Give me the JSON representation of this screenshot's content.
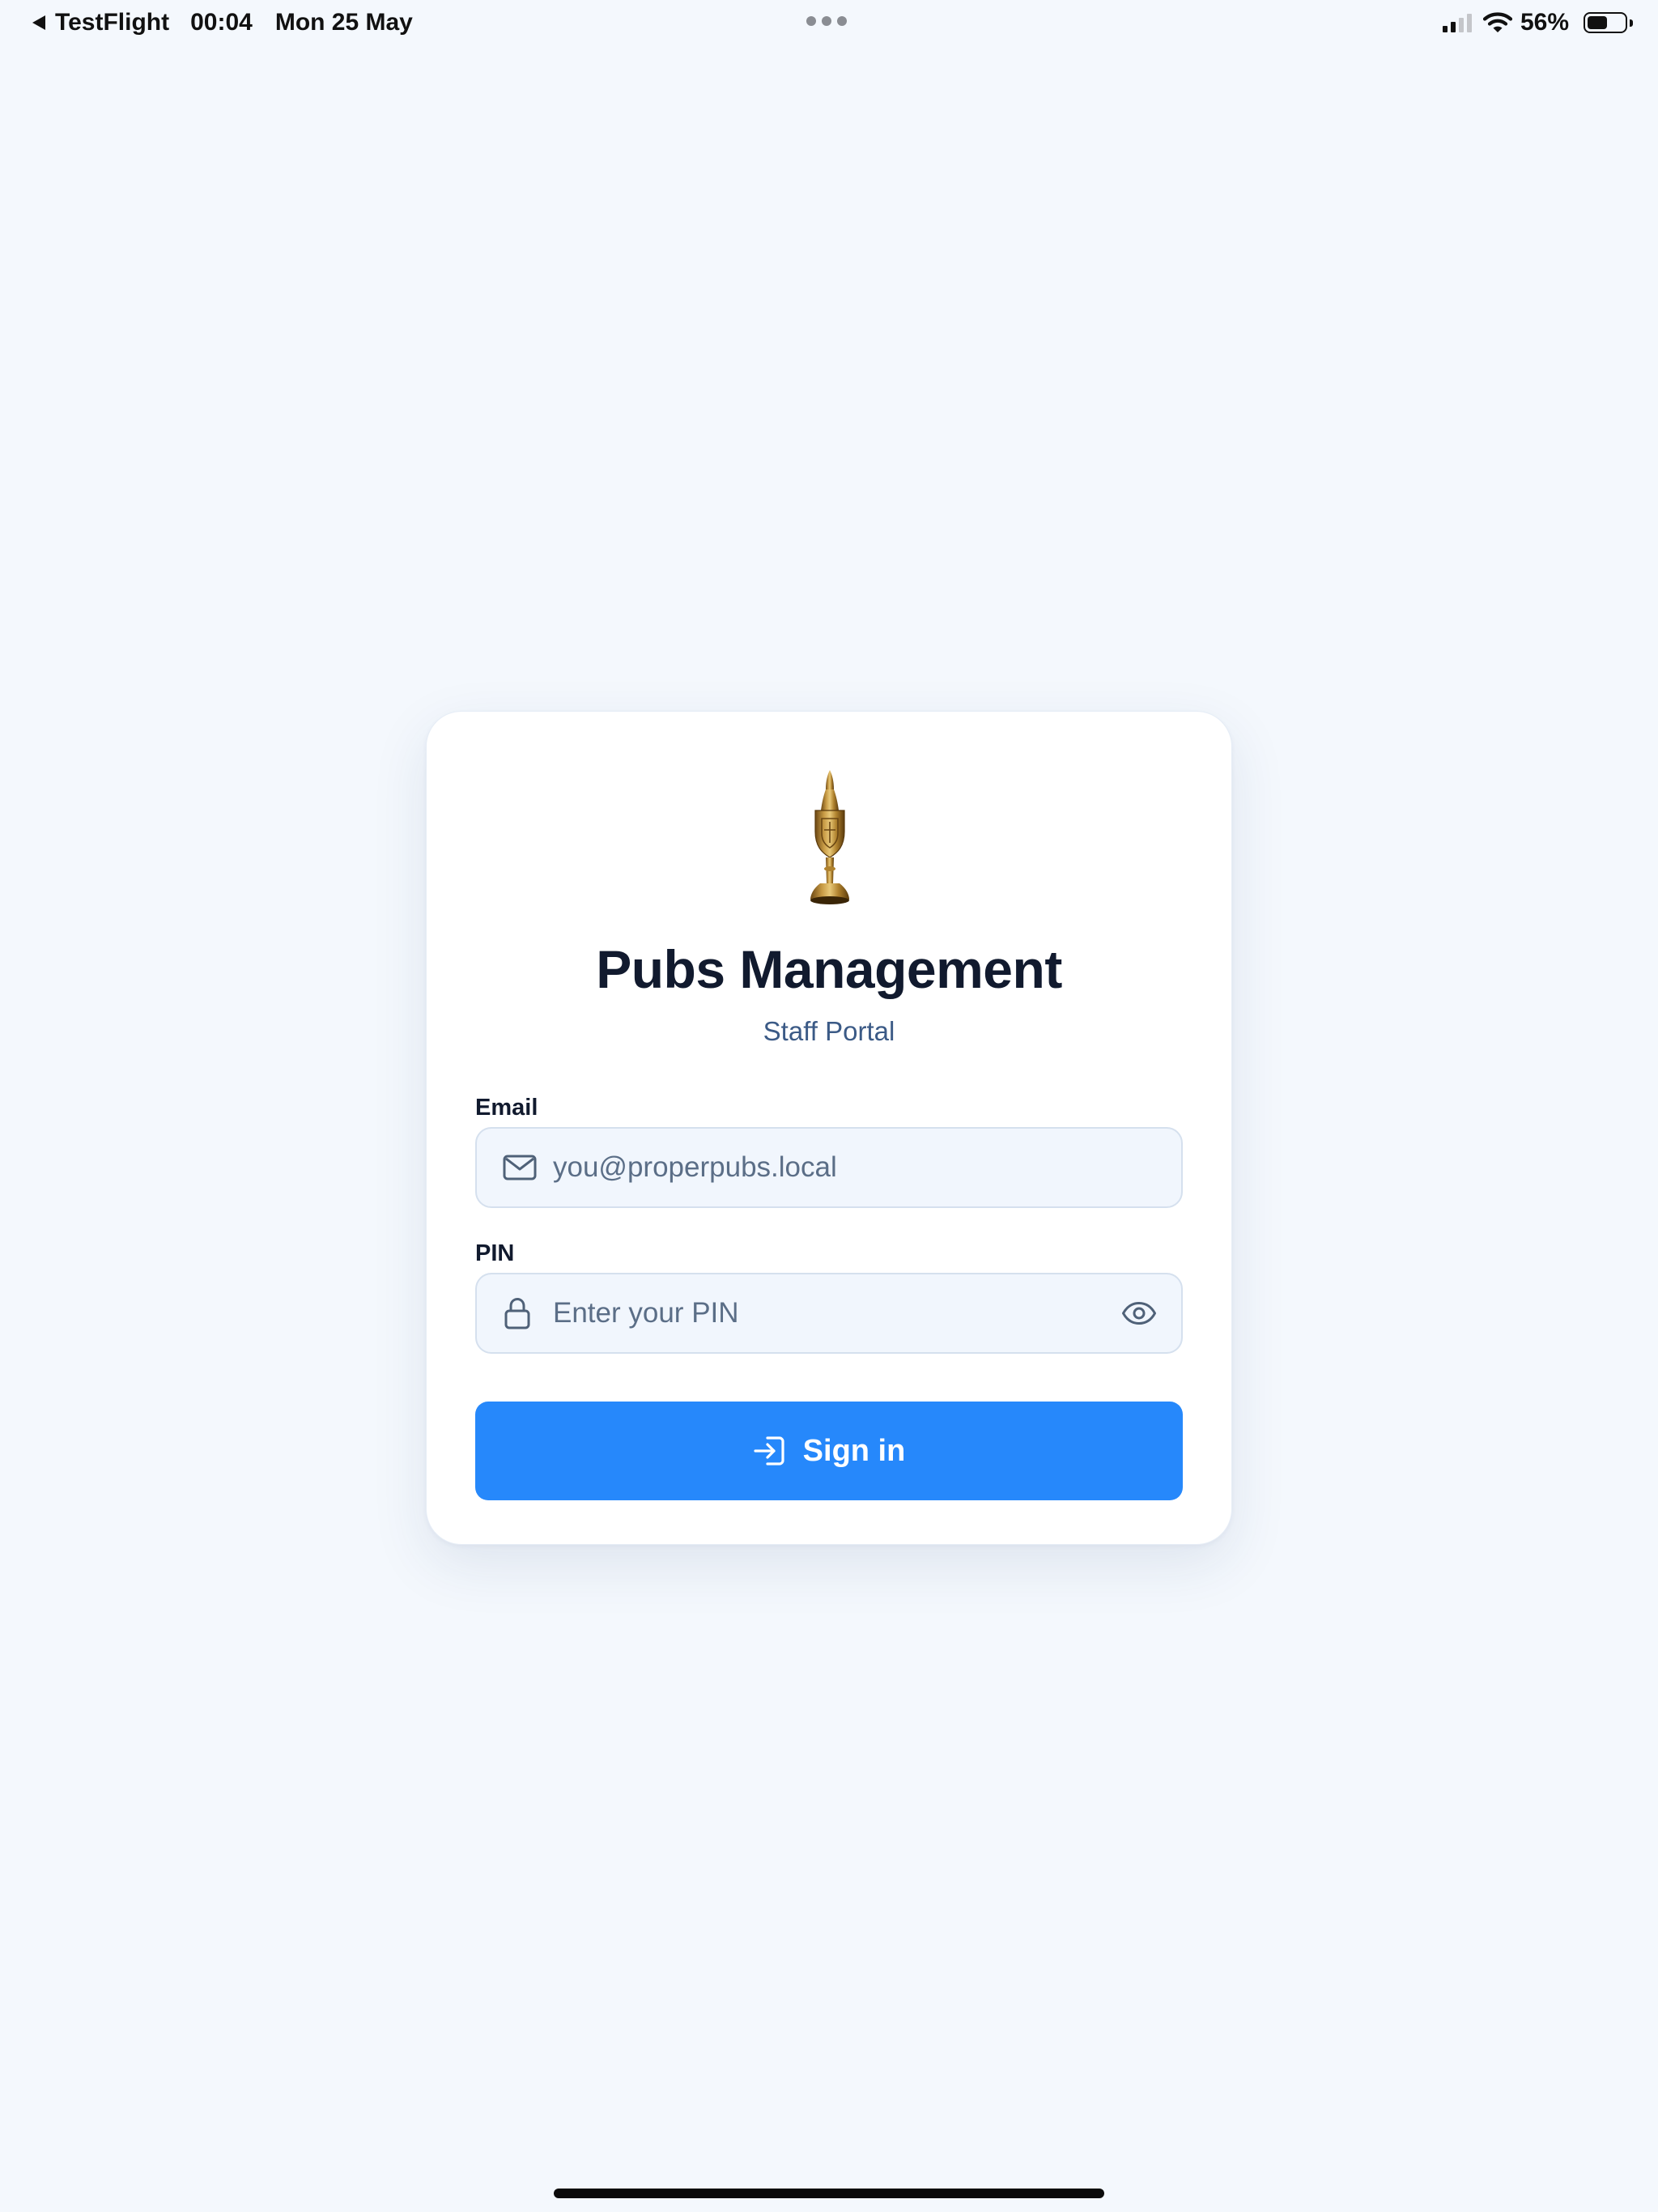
{
  "status_bar": {
    "back_app": "TestFlight",
    "time": "00:04",
    "date": "Mon 25 May",
    "battery_percent": "56%",
    "battery_level": 0.56,
    "signal_bars_active": 2,
    "signal_bars_total": 4
  },
  "login": {
    "logo_icon": "beer-pump-icon",
    "title": "Pubs Management",
    "subtitle": "Staff Portal",
    "email": {
      "label": "Email",
      "placeholder": "you@properpubs.local",
      "value": "",
      "icon": "mail-icon"
    },
    "pin": {
      "label": "PIN",
      "placeholder": "Enter your PIN",
      "value": "",
      "icon": "lock-icon",
      "toggle_icon": "eye-icon"
    },
    "submit": {
      "label": "Sign in",
      "icon": "login-icon"
    }
  },
  "colors": {
    "background": "#f4f8fd",
    "accent": "#2688fb",
    "title": "#111a2e",
    "subtitle": "#3b5a86",
    "input_background": "#f1f6fd",
    "input_border": "#d5e0ee"
  }
}
